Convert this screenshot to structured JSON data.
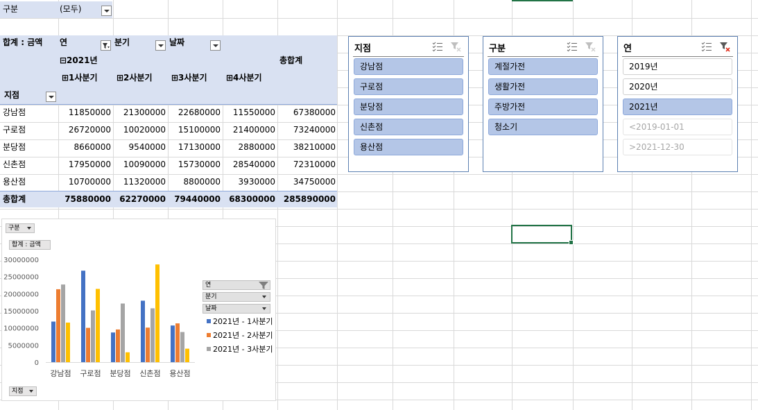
{
  "report_filter": {
    "label": "구분",
    "value": "(모두)"
  },
  "pivot": {
    "value_label": "합계 : 금액",
    "col_fields": [
      "연",
      "분기",
      "날짜"
    ],
    "year_label": "⊟2021년",
    "grand_total_header": "총합계",
    "quarters": [
      "⊞1사분기",
      "⊞2사분기",
      "⊞3사분기",
      "⊞4사분기"
    ],
    "row_field": "지점",
    "rows": [
      {
        "name": "강남점",
        "values": [
          "11850000",
          "21300000",
          "22680000",
          "11550000",
          "67380000"
        ]
      },
      {
        "name": "구로점",
        "values": [
          "26720000",
          "10020000",
          "15100000",
          "21400000",
          "73240000"
        ]
      },
      {
        "name": "분당점",
        "values": [
          "8660000",
          "9540000",
          "17130000",
          "2880000",
          "38210000"
        ]
      },
      {
        "name": "신촌점",
        "values": [
          "17950000",
          "10090000",
          "15730000",
          "28540000",
          "72310000"
        ]
      },
      {
        "name": "용산점",
        "values": [
          "10700000",
          "11320000",
          "8800000",
          "3930000",
          "34750000"
        ]
      }
    ],
    "total_row": {
      "name": "총합계",
      "values": [
        "75880000",
        "62270000",
        "79440000",
        "68300000",
        "285890000"
      ]
    }
  },
  "slicers": [
    {
      "title": "지점",
      "items": [
        {
          "label": "강남점",
          "state": "selected"
        },
        {
          "label": "구로점",
          "state": "selected"
        },
        {
          "label": "분당점",
          "state": "selected"
        },
        {
          "label": "신촌점",
          "state": "selected"
        },
        {
          "label": "용산점",
          "state": "selected"
        }
      ]
    },
    {
      "title": "구분",
      "items": [
        {
          "label": "계절가전",
          "state": "selected"
        },
        {
          "label": "생활가전",
          "state": "selected"
        },
        {
          "label": "주방가전",
          "state": "selected"
        },
        {
          "label": "청소기",
          "state": "selected"
        }
      ]
    },
    {
      "title": "연",
      "items": [
        {
          "label": "2019년",
          "state": "unselected"
        },
        {
          "label": "2020년",
          "state": "unselected"
        },
        {
          "label": "2021년",
          "state": "selected"
        },
        {
          "label": "<2019-01-01",
          "state": "nodata"
        },
        {
          "label": ">2021-12-30",
          "state": "nodata"
        }
      ]
    }
  ],
  "chart_buttons": {
    "filter": "구분",
    "value": "합계 : 금액",
    "axis": "지점",
    "legend_fields": [
      "연",
      "분기",
      "날짜"
    ]
  },
  "icons": {
    "multi_select": "multi-select-icon",
    "clear_filter": "clear-filter-icon"
  },
  "colors": {
    "header_fill": "#d9e1f2",
    "slicer_selected": "#b4c6e7",
    "q1": "#4472c4",
    "q2": "#ed7d31",
    "q3": "#a5a5a5",
    "q4": "#ffc000"
  },
  "chart_data": {
    "type": "bar",
    "categories": [
      "강남점",
      "구로점",
      "분당점",
      "신촌점",
      "용산점"
    ],
    "series": [
      {
        "name": "2021년 - 1사분기",
        "color": "#4472c4",
        "values": [
          11850000,
          26720000,
          8660000,
          17950000,
          10700000
        ]
      },
      {
        "name": "2021년 - 2사분기",
        "color": "#ed7d31",
        "values": [
          21300000,
          10020000,
          9540000,
          10090000,
          11320000
        ]
      },
      {
        "name": "2021년 - 3사분기",
        "color": "#a5a5a5",
        "values": [
          22680000,
          15100000,
          17130000,
          15730000,
          8800000
        ]
      },
      {
        "color": "#ffc000",
        "values": [
          11550000,
          21400000,
          2880000,
          28540000,
          3930000
        ]
      }
    ],
    "y_ticks": [
      "30000000",
      "25000000",
      "20000000",
      "15000000",
      "10000000",
      "5000000",
      "0"
    ],
    "ylim": [
      0,
      30000000
    ],
    "legend_visible": [
      "2021년 - 1사분기",
      "2021년 - 2사분기",
      "2021년 - 3사분기"
    ],
    "grid": false
  }
}
